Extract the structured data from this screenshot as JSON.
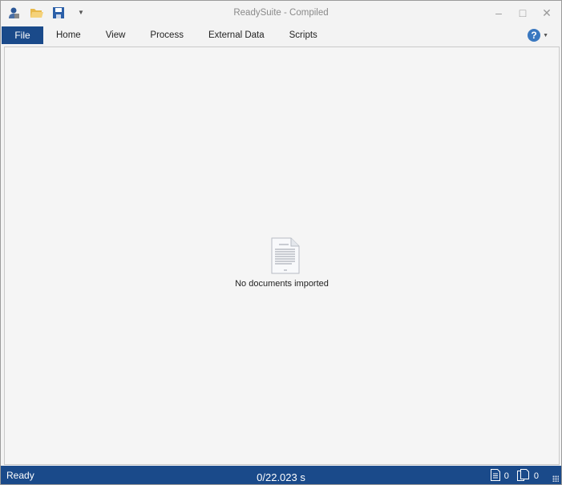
{
  "window": {
    "title": "ReadySuite - Compiled"
  },
  "quick_access": [
    {
      "icon": "user-icon"
    },
    {
      "icon": "open-folder-icon"
    },
    {
      "icon": "save-icon"
    },
    {
      "icon": "customize-dropdown-icon"
    }
  ],
  "ribbon": {
    "file_label": "File",
    "tabs": [
      {
        "label": "Home"
      },
      {
        "label": "View"
      },
      {
        "label": "Process"
      },
      {
        "label": "External Data"
      },
      {
        "label": "Scripts"
      }
    ],
    "help_icon": "help-icon"
  },
  "main": {
    "empty_text": "No documents imported"
  },
  "status": {
    "state": "Ready",
    "timer": "0/22.023 s",
    "documents_count": "0",
    "pages_count": "0"
  },
  "colors": {
    "accent": "#1a4a8a",
    "help": "#3a78c0"
  }
}
